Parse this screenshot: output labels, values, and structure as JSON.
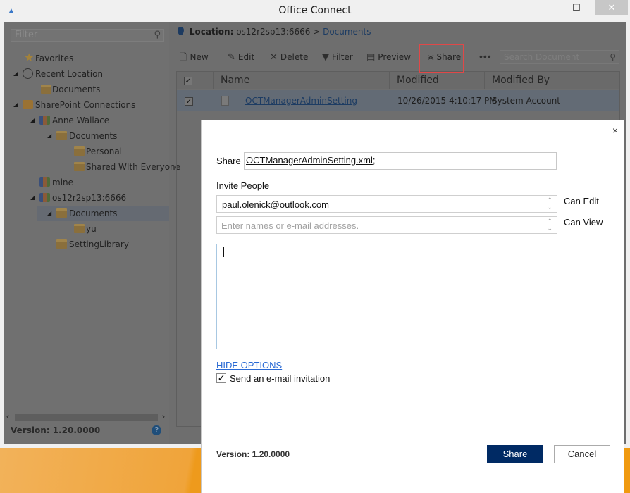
{
  "window": {
    "title": "Office Connect",
    "minimize": "–",
    "maximize": "☐",
    "close": "✕"
  },
  "sidebar": {
    "filter_placeholder": "Filter",
    "tree": [
      {
        "label": "Favorites",
        "icon": "star-icon",
        "level": 0,
        "expanded": null
      },
      {
        "label": "Recent Location",
        "icon": "clock-icon",
        "level": 0,
        "expanded": true
      },
      {
        "label": "Documents",
        "icon": "folder-icon",
        "level": 1,
        "expanded": null
      },
      {
        "label": "SharePoint Connections",
        "icon": "sharepoint-icon",
        "level": 0,
        "expanded": true
      },
      {
        "label": "Anne Wallace",
        "icon": "site-icon",
        "level": 1,
        "expanded": true
      },
      {
        "label": "Documents",
        "icon": "library-icon",
        "level": 2,
        "expanded": true
      },
      {
        "label": "Personal",
        "icon": "library-icon",
        "level": 3,
        "expanded": null
      },
      {
        "label": "Shared WIth Everyone",
        "icon": "library-icon",
        "level": 3,
        "expanded": null
      },
      {
        "label": "mine",
        "icon": "site-icon",
        "level": 1,
        "expanded": null
      },
      {
        "label": "os12r2sp13:6666",
        "icon": "site-icon",
        "level": 1,
        "expanded": true
      },
      {
        "label": "Documents",
        "icon": "folder-icon",
        "level": 2,
        "expanded": true,
        "selected": true
      },
      {
        "label": "yu",
        "icon": "folder-icon",
        "level": 3,
        "expanded": null
      },
      {
        "label": "SettingLibrary",
        "icon": "folder-icon",
        "level": 2,
        "expanded": null
      }
    ],
    "version": "Version: 1.20.0000",
    "help": "?"
  },
  "main": {
    "location_label": "Location:",
    "location_host": "os12r2sp13:6666",
    "location_sep": ">",
    "location_folder": "Documents",
    "toolbar": {
      "new": "New",
      "edit": "Edit",
      "delete": "Delete",
      "filter": "Filter",
      "preview": "Preview",
      "share": "Share",
      "more": "•••"
    },
    "search_placeholder": "Search Document",
    "columns": [
      "Name",
      "Modified",
      "Modified By"
    ],
    "rows": [
      {
        "checked": true,
        "name": "OCTManagerAdminSetting",
        "modified": "10/26/2015 4:10:17 PM",
        "modified_by": "System Account"
      }
    ]
  },
  "dialog": {
    "close": "×",
    "share_label": "Share",
    "share_file": "OCTManagerAdminSetting.xml",
    "share_suffix": ";",
    "invite_label": "Invite People",
    "invite_edit_value": "paul.olenick@outlook.com",
    "invite_view_placeholder": "Enter names or e-mail addresses.",
    "can_edit": "Can Edit",
    "can_view": "Can View",
    "message_value": "",
    "hide_options": "HIDE OPTIONS",
    "send_email_checked": true,
    "send_email_label": "Send an e-mail invitation",
    "version": "Version: 1.20.0000",
    "share_button": "Share",
    "cancel_button": "Cancel",
    "primary_color": "#002a64"
  }
}
